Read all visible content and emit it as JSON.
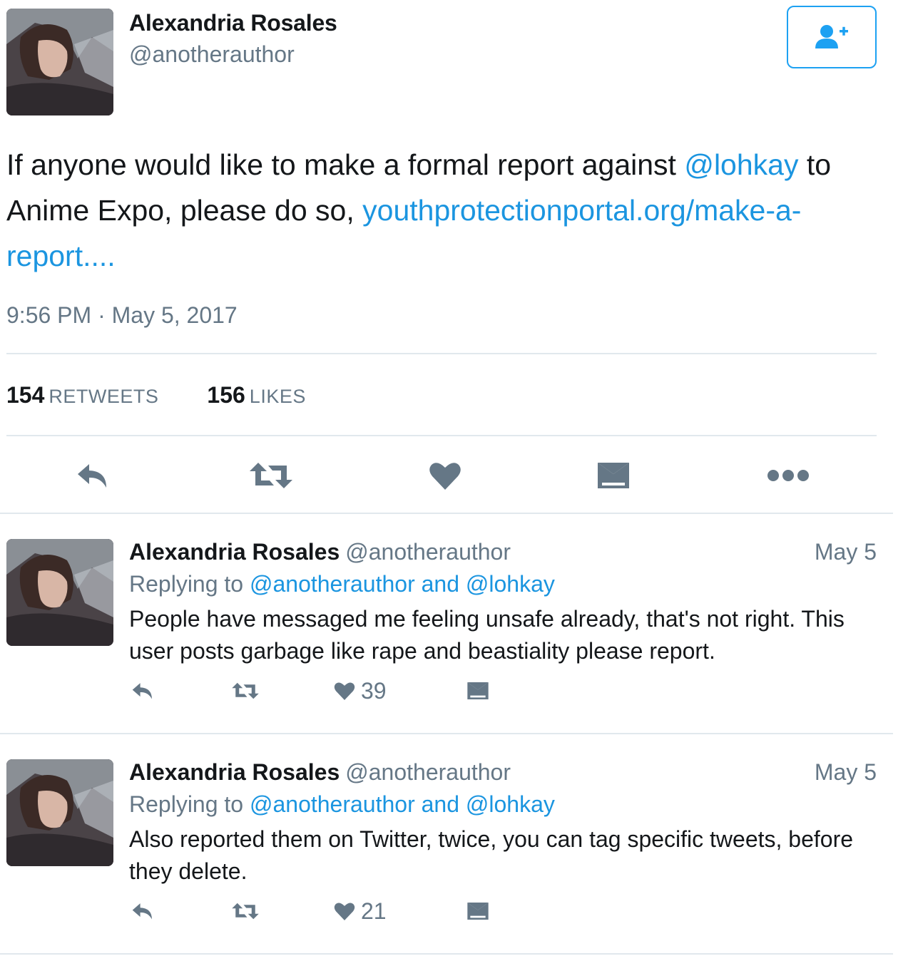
{
  "main": {
    "name": "Alexandria Rosales",
    "handle": "@anotherauthor",
    "text_1": "If anyone would like to make a formal report against ",
    "mention": "@lohkay",
    "text_2": " to Anime Expo, please do so, ",
    "link": "youthprotectionportal.org/make-a-report....",
    "timestamp": "9:56 PM · May 5, 2017",
    "retweets_count": "154",
    "retweets_label": "RETWEETS",
    "likes_count": "156",
    "likes_label": "LIKES"
  },
  "replies": [
    {
      "name": "Alexandria Rosales",
      "handle": "@anotherauthor",
      "date": "May 5",
      "replying_prefix": "Replying to ",
      "replying_targets": "@anotherauthor and @lohkay",
      "text": "People have messaged me feeling unsafe already, that's not right. This user posts garbage like rape and beastiality please report.",
      "likes": "39"
    },
    {
      "name": "Alexandria Rosales",
      "handle": "@anotherauthor",
      "date": "May 5",
      "replying_prefix": "Replying to ",
      "replying_targets": "@anotherauthor and @lohkay",
      "text": "Also reported them on Twitter, twice, you can tag specific tweets, before they delete.",
      "likes": "21"
    }
  ],
  "colors": {
    "link": "#1b95e0",
    "secondary": "#657786",
    "icon": "#657786",
    "divider": "#e1e8ed",
    "follow": "#1da1f2"
  },
  "icons": [
    "follow-user-icon",
    "reply-icon",
    "retweet-icon",
    "like-icon",
    "direct-message-icon",
    "more-icon"
  ]
}
